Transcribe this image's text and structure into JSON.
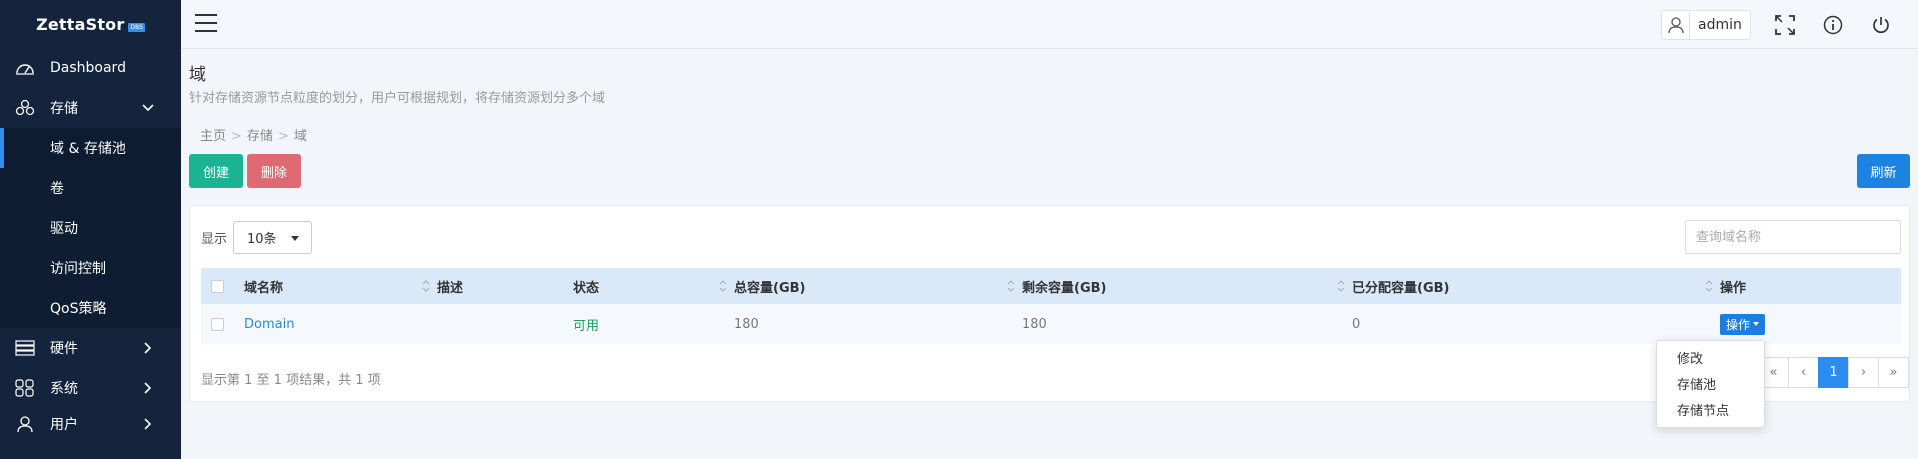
{
  "app": {
    "logo_text": "ZettaStor",
    "logo_badge": "DBS"
  },
  "sidebar": {
    "items": [
      {
        "label": "Dashboard",
        "icon": "speedometer-icon"
      },
      {
        "label": "存储",
        "icon": "storage-nodes-icon",
        "expanded": true,
        "children": [
          {
            "label": "域 & 存储池",
            "active": true
          },
          {
            "label": "卷"
          },
          {
            "label": "驱动"
          },
          {
            "label": "访问控制"
          },
          {
            "label": "QoS策略"
          }
        ]
      },
      {
        "label": "硬件",
        "icon": "server-rack-icon"
      },
      {
        "label": "系统",
        "icon": "grid-apps-icon"
      },
      {
        "label": "用户",
        "icon": "user-icon"
      }
    ]
  },
  "topbar": {
    "username": "admin"
  },
  "page": {
    "title": "域",
    "description": "针对存储资源节点粒度的划分，用户可根据规划，将存储资源划分多个域",
    "breadcrumb": [
      "主页",
      "存储",
      "域"
    ],
    "breadcrumb_sep": ">"
  },
  "actions": {
    "create": "创建",
    "delete": "删除",
    "refresh": "刷新"
  },
  "table_controls": {
    "show_label": "显示",
    "page_size": "10条",
    "search_placeholder": "查询域名称"
  },
  "table": {
    "columns": [
      "域名称",
      "描述",
      "状态",
      "总容量(GB)",
      "剩余容量(GB)",
      "已分配容量(GB)",
      "操作"
    ],
    "rows": [
      {
        "name": "Domain",
        "description": "",
        "status": "可用",
        "total": "180",
        "remaining": "180",
        "allocated": "0",
        "op_label": "操作"
      }
    ]
  },
  "footer": {
    "info": "显示第 1 至 1 项结果，共 1 项",
    "pager": [
      "«",
      "‹",
      "1",
      "›",
      "»"
    ],
    "current_page": "1"
  },
  "dropdown": {
    "items": [
      "修改",
      "存储池",
      "存储节点"
    ]
  },
  "colors": {
    "sidebar_bg": "#14243d",
    "create": "#1ab394",
    "delete": "#e06a73",
    "refresh": "#1c84e0",
    "header_row": "#d9e9f9",
    "status_ok": "#1a9f5c"
  }
}
